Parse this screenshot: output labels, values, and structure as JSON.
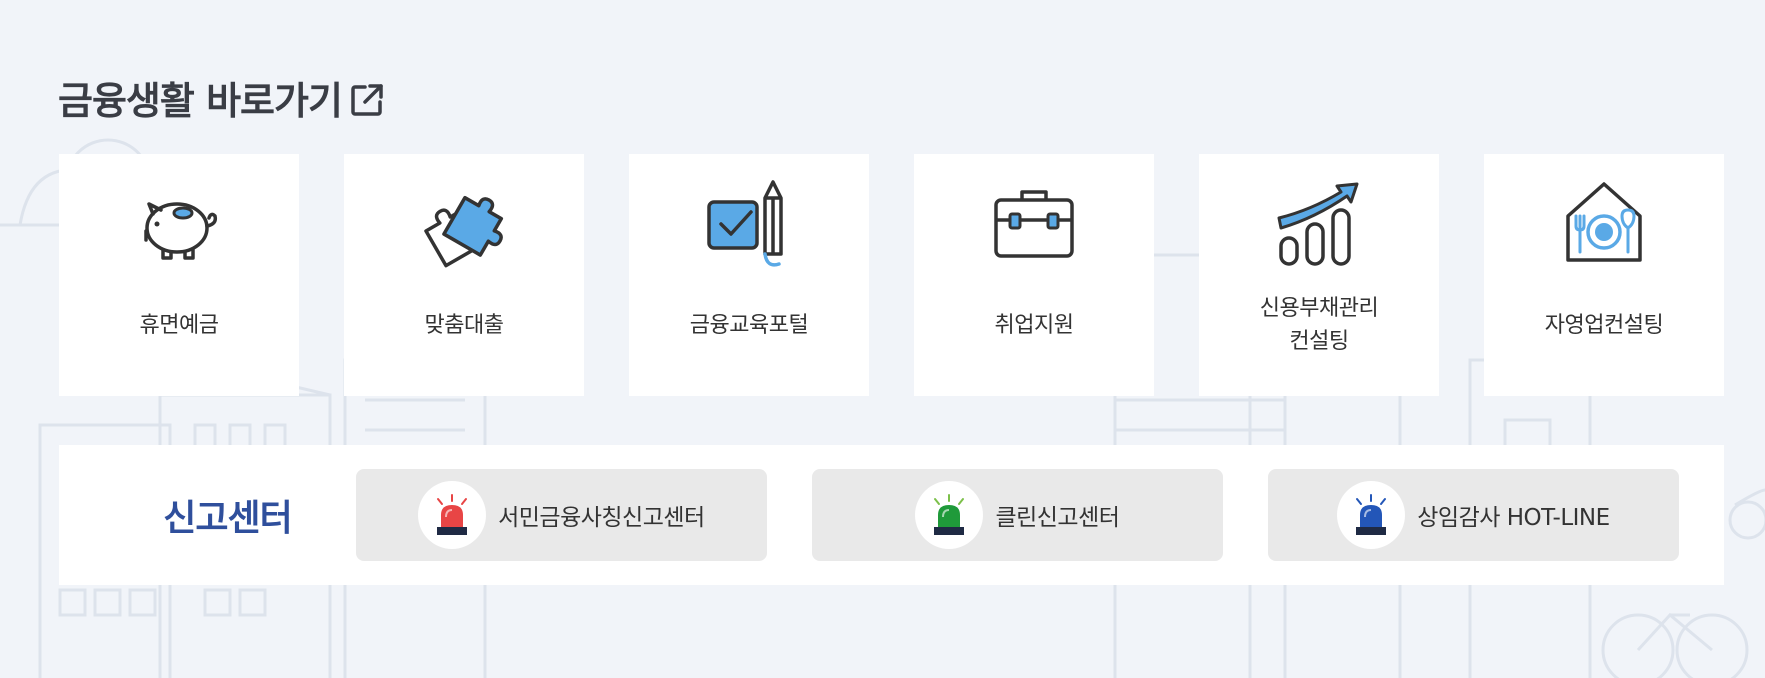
{
  "section_title": "금융생활 바로가기",
  "icons": {
    "external_link": "external-link-icon"
  },
  "cards": [
    {
      "label": "휴면예금",
      "icon": "piggy-bank-icon"
    },
    {
      "label": "맞춤대출",
      "icon": "puzzle-icon"
    },
    {
      "label": "금융교육포털",
      "icon": "checkbox-pencil-icon"
    },
    {
      "label": "취업지원",
      "icon": "briefcase-icon"
    },
    {
      "label": "신용부채관리\n컨설팅",
      "icon": "growth-chart-icon"
    },
    {
      "label": "자영업컨설팅",
      "icon": "restaurant-house-icon"
    }
  ],
  "report_center": {
    "title": "신고센터",
    "buttons": [
      {
        "label": "서민금융사칭신고센터",
        "icon": "red-siren-icon",
        "color": "#e84545"
      },
      {
        "label": "클린신고센터",
        "icon": "green-siren-icon",
        "color": "#1f9a3a"
      },
      {
        "label": "상임감사 HOT-LINE",
        "icon": "blue-siren-icon",
        "color": "#2356b8"
      }
    ]
  },
  "colors": {
    "accent": "#2f4f9c",
    "icon_blue": "#5aa9e6",
    "background": "#f1f4f9"
  }
}
